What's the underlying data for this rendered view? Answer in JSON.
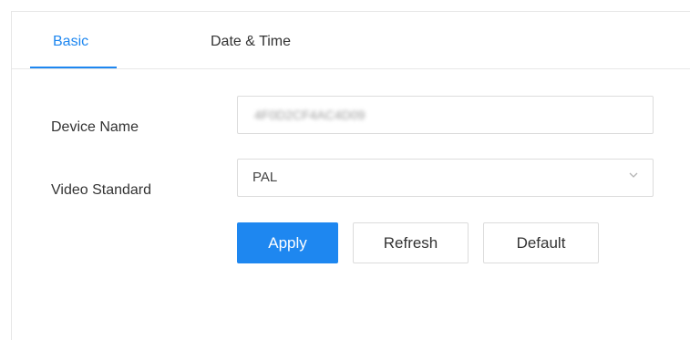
{
  "tabs": {
    "basic": "Basic",
    "date_time": "Date & Time",
    "active": "Basic"
  },
  "form": {
    "device_name_label": "Device Name",
    "device_name_value": "4F0D2CF4AC4D09",
    "video_standard_label": "Video Standard",
    "video_standard_value": "PAL"
  },
  "buttons": {
    "apply": "Apply",
    "refresh": "Refresh",
    "default": "Default"
  },
  "colors": {
    "accent": "#1e87f0",
    "border": "#dcdcdc",
    "text": "#333333"
  },
  "icons": {
    "dropdown": "chevron-down-icon"
  }
}
